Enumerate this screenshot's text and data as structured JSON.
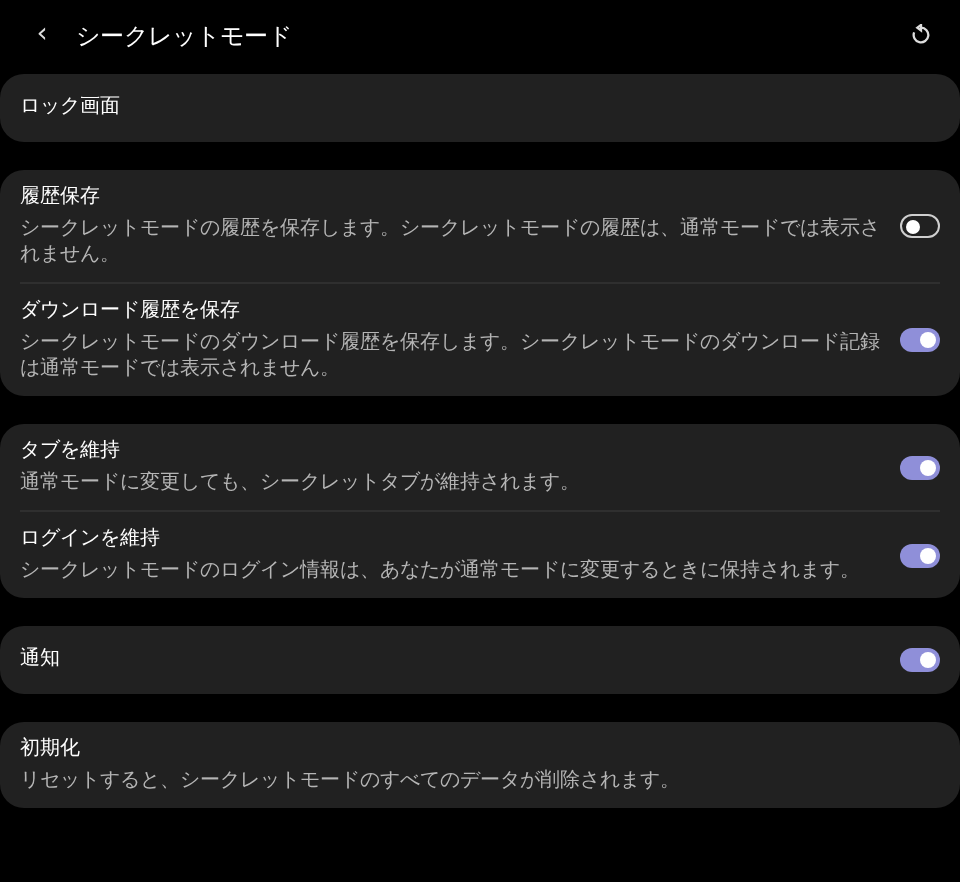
{
  "header": {
    "back": "‹",
    "title": "シークレットモード"
  },
  "groups": [
    {
      "items": [
        {
          "kind": "plain",
          "title": "ロック画面"
        }
      ]
    },
    {
      "items": [
        {
          "kind": "toggle",
          "title": "履歴保存",
          "description": "シークレットモードの履歴を保存します。シークレットモードの履歴は、通常モードでは表示されません。",
          "on": false
        },
        {
          "kind": "toggle",
          "title": "ダウンロード履歴を保存",
          "description": "シークレットモードのダウンロード履歴を保存します。シークレットモードのダウンロード記録は通常モードでは表示されません。",
          "on": true
        }
      ]
    },
    {
      "items": [
        {
          "kind": "toggle",
          "title": "タブを維持",
          "description": "通常モードに変更しても、シークレットタブが維持されます。",
          "on": true
        },
        {
          "kind": "toggle",
          "title": "ログインを維持",
          "description": "シークレットモードのログイン情報は、あなたが通常モードに変更するときに保持されます。",
          "on": true
        }
      ]
    },
    {
      "items": [
        {
          "kind": "toggle",
          "title": "通知",
          "on": true
        }
      ]
    },
    {
      "items": [
        {
          "kind": "plain",
          "title": "初期化",
          "description": "リセットすると、シークレットモードのすべてのデータが削除されます。"
        }
      ]
    }
  ]
}
